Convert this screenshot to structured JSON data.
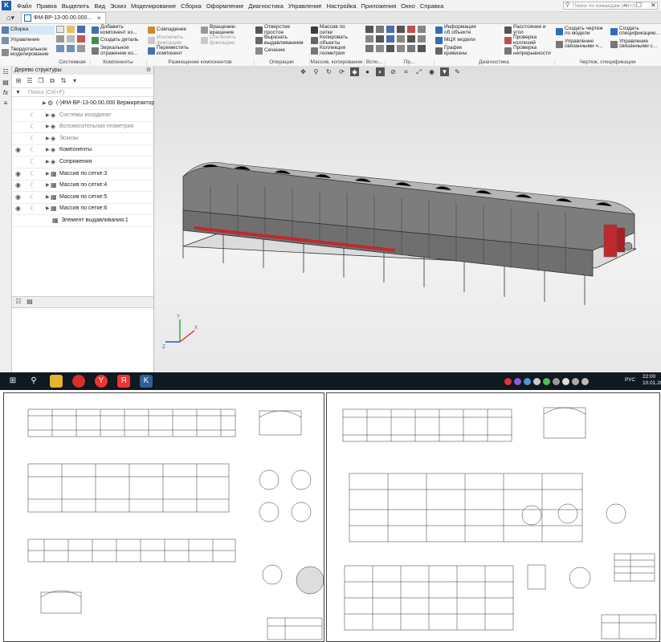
{
  "menu": {
    "items": [
      "Файл",
      "Правка",
      "Выделить",
      "Вид",
      "Эскиз",
      "Моделирование",
      "Сборка",
      "Оформление",
      "Диагностика",
      "Управление",
      "Настройка",
      "Приложения",
      "Окно",
      "Справка"
    ],
    "search_placeholder": "Поиск по командам (Alt+/)"
  },
  "document_tab": {
    "title": "ФМ-ВР-13-00.00.000..."
  },
  "ribbon": {
    "left_tabs": [
      "Сборка",
      "Управление",
      "Твердотельное моделирование"
    ],
    "col1": [
      "Добавить компонент из...",
      "Создать деталь",
      "Зеркальное отражение ко..."
    ],
    "col2": [
      "Совпадение",
      "Исключить фиксацию",
      "Переместить компонент"
    ],
    "col3": [
      "Вращение-вращение",
      "Отключить фиксацию"
    ],
    "col4": [
      "Отверстие простое",
      "Вырезать выдавливанием",
      "Сечение"
    ],
    "col5": [
      "Массив по сетке",
      "Копировать объекты",
      "Коллекция геометрии"
    ],
    "col6": [
      "Информация об объекте",
      "МЦХ модели",
      "График кривизны"
    ],
    "col7": [
      "Расстояние и угол",
      "Проверка коллизий",
      "Проверка непрерывности"
    ],
    "col8": [
      "Создать чертеж по модели",
      "Управление связанными ч..."
    ],
    "col9": [
      "Создать спецификацию...",
      "Управление связанными с..."
    ],
    "groups": [
      "Системная",
      "Компоненты",
      "Размещение компонентов",
      "Операции",
      "Массив, копирование",
      "Вспо...",
      "Пр...",
      "Диагностика",
      "Чертеж, спецификация"
    ]
  },
  "tree": {
    "title": "Дерево структуры",
    "search_placeholder": "Поиск (Ctrl+F)",
    "nodes": [
      {
        "label": "(-)ФМ-ВР-13-00.00.000 Вермиреактор (",
        "eye": false,
        "grey": false
      },
      {
        "label": "Системы координат",
        "eye": false,
        "grey": true
      },
      {
        "label": "Вспомогательная геометрия",
        "eye": false,
        "grey": true
      },
      {
        "label": "Эскизы",
        "eye": false,
        "grey": true
      },
      {
        "label": "Компоненты",
        "eye": true,
        "grey": false
      },
      {
        "label": "Сопряжения",
        "eye": false,
        "grey": false
      },
      {
        "label": "Массив по сетке:3",
        "eye": true,
        "grey": false
      },
      {
        "label": "Массив по сетке:4",
        "eye": true,
        "grey": false
      },
      {
        "label": "Массив по сетке:5",
        "eye": true,
        "grey": false
      },
      {
        "label": "Массив по сетке:6",
        "eye": true,
        "grey": false
      },
      {
        "label": "Элемент выдавливания:1",
        "eye": false,
        "grey": false
      }
    ]
  },
  "taskbar": {
    "lang": "РУС",
    "time": "22:00",
    "date": "10.01.20"
  },
  "colors": {
    "accent": "#1b5fa8",
    "model_red": "#c0292b",
    "taskbar": "#101820"
  }
}
